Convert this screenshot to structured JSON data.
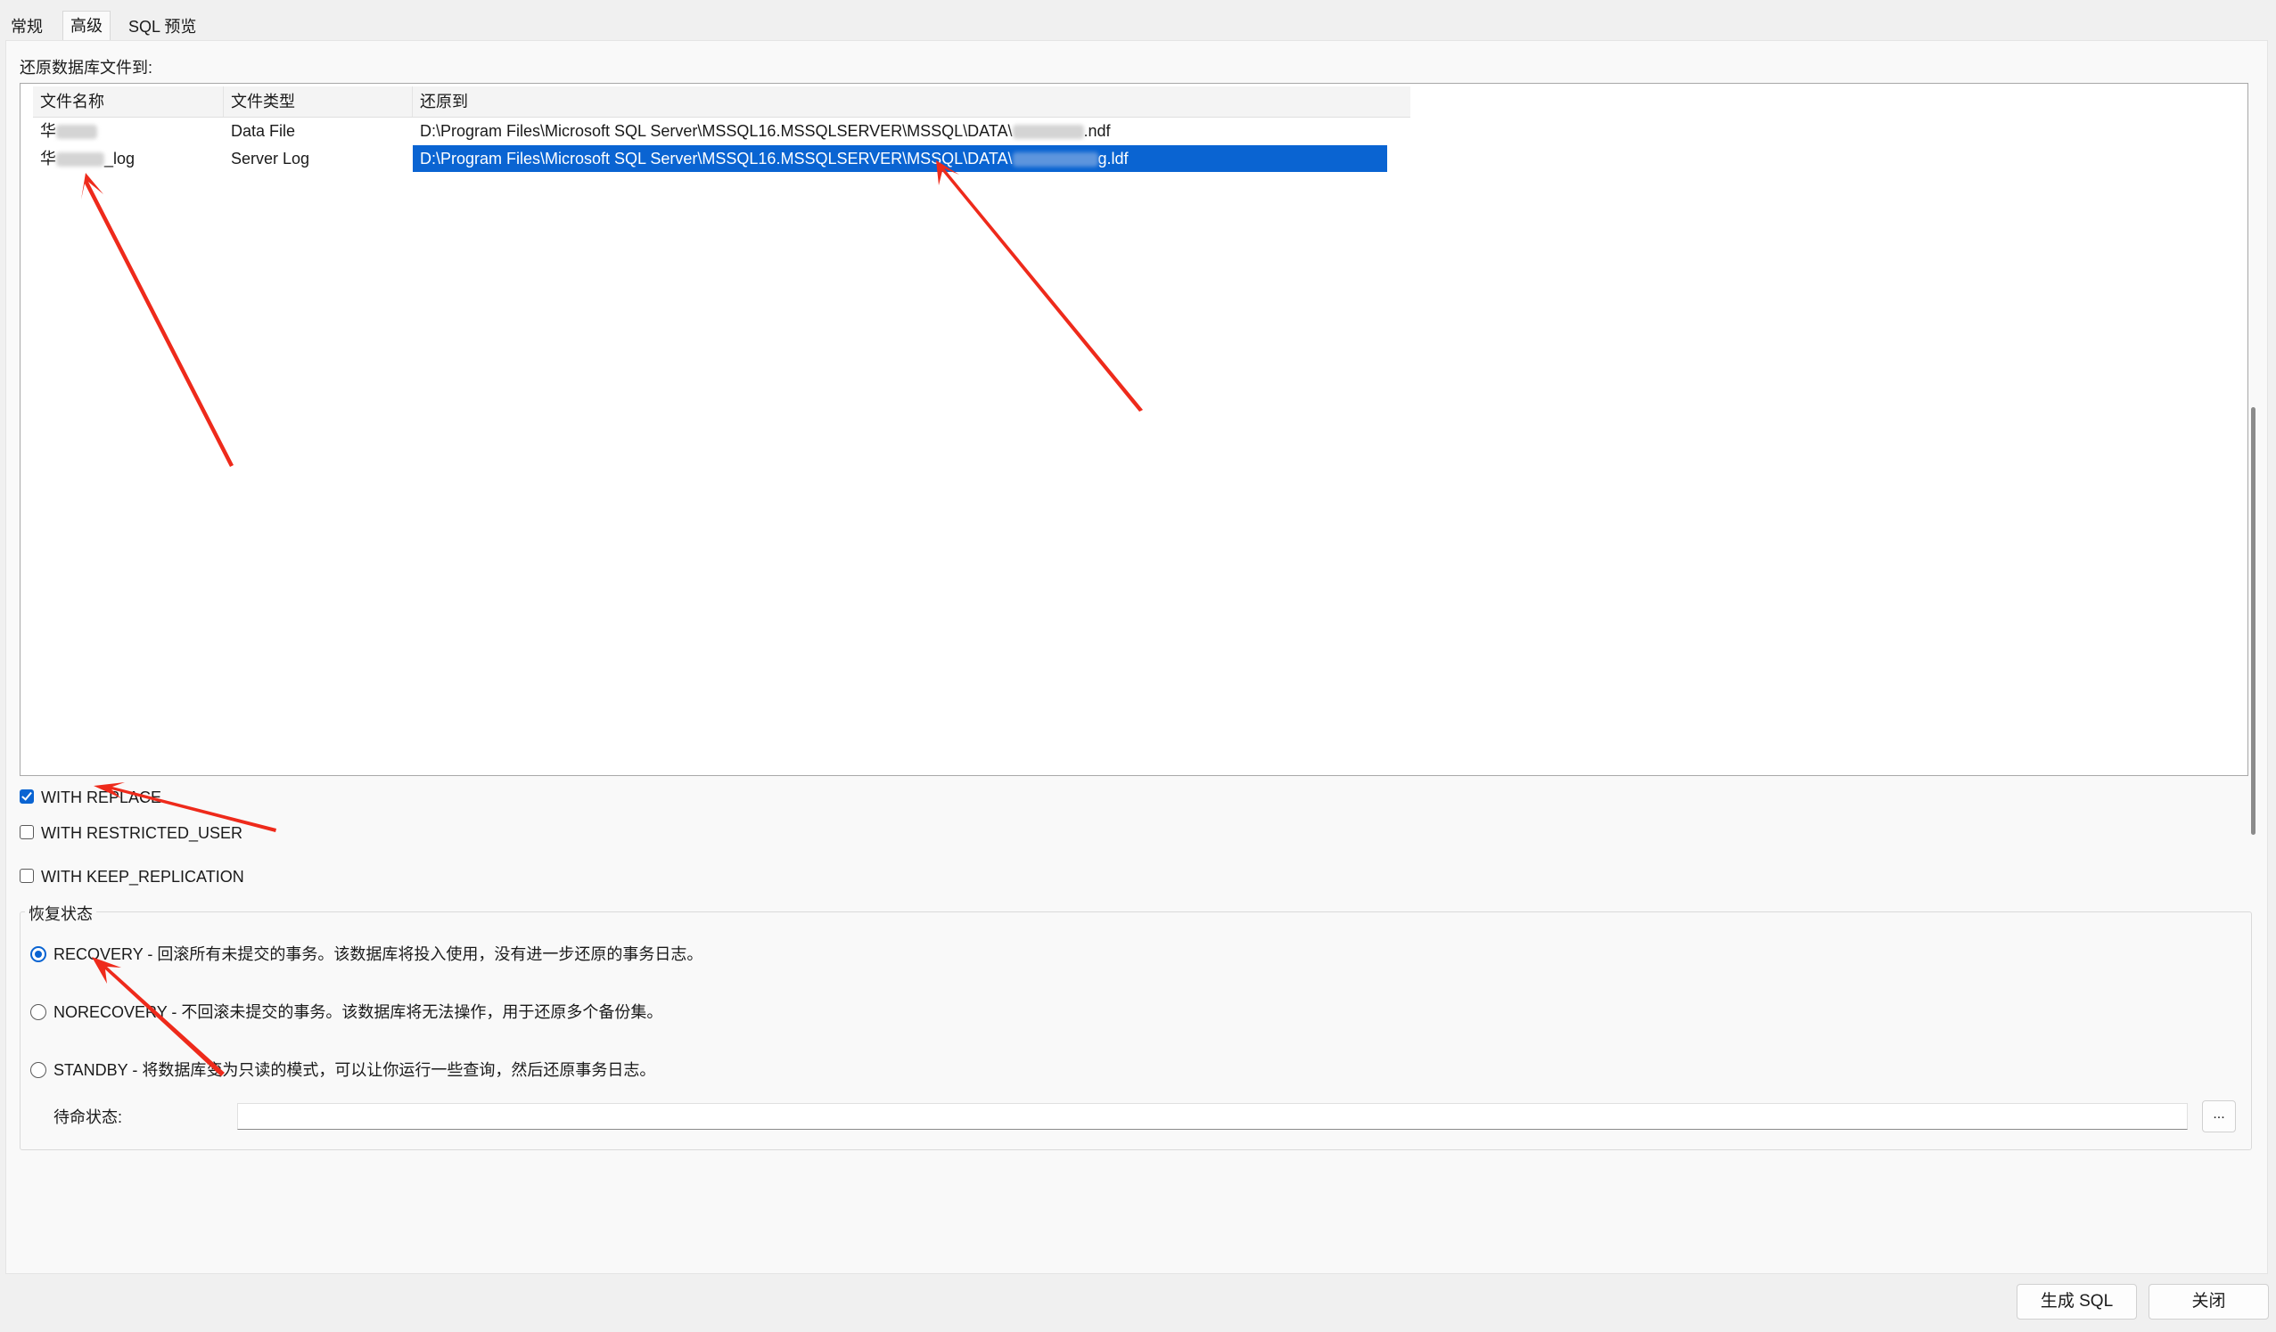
{
  "tabs": [
    {
      "label": "常规",
      "active": false
    },
    {
      "label": "高级",
      "active": true
    },
    {
      "label": "SQL 预览",
      "active": false
    }
  ],
  "files_section": {
    "title": "还原数据库文件到:",
    "columns": [
      "文件名称",
      "文件类型",
      "还原到"
    ],
    "rows": [
      {
        "name": "华",
        "name_suffix": "",
        "type": "Data File",
        "restore_prefix": "D:\\Program Files\\Microsoft SQL Server\\MSSQL16.MSSQLSERVER\\MSSQL\\DATA\\",
        "restore_suffix": ".ndf",
        "selected": false
      },
      {
        "name": "华",
        "name_suffix": "_log",
        "type": "Server Log",
        "restore_prefix": "D:\\Program Files\\Microsoft SQL Server\\MSSQL16.MSSQLSERVER\\MSSQL\\DATA\\",
        "restore_suffix": "g.ldf",
        "selected": true
      }
    ]
  },
  "options": [
    {
      "label": "WITH REPLACE",
      "checked": true
    },
    {
      "label": "WITH RESTRICTED_USER",
      "checked": false
    },
    {
      "label": "WITH KEEP_REPLICATION",
      "checked": false
    }
  ],
  "recovery_state": {
    "title": "恢复状态",
    "choices": [
      {
        "label": "RECOVERY - 回滚所有未提交的事务。该数据库将投入使用，没有进一步还原的事务日志。",
        "checked": true
      },
      {
        "label": "NORECOVERY - 不回滚未提交的事务。该数据库将无法操作，用于还原多个备份集。",
        "checked": false
      },
      {
        "label": "STANDBY - 将数据库变为只读的模式，可以让你运行一些查询，然后还原事务日志。",
        "checked": false
      }
    ],
    "standby_label": "待命状态:",
    "standby_value": "",
    "browse_label": "..."
  },
  "footer": {
    "generate_sql": "生成 SQL",
    "close": "关闭"
  },
  "colors": {
    "selection": "#0a64d2",
    "annotation_arrow": "#ee2a1b"
  }
}
